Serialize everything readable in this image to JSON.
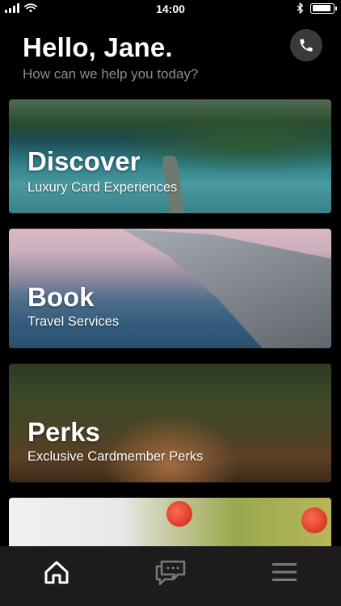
{
  "status_bar": {
    "time": "14:00",
    "signal_bars": 4,
    "battery_level": 0.92
  },
  "header": {
    "greeting": "Hello, Jane.",
    "subtitle": "How can we help you today?",
    "call_icon": "phone-icon"
  },
  "cards": [
    {
      "title": "Discover",
      "subtitle": "Luxury Card Experiences"
    },
    {
      "title": "Book",
      "subtitle": "Travel Services"
    },
    {
      "title": "Perks",
      "subtitle": "Exclusive Cardmember Perks"
    },
    {
      "title": "",
      "subtitle": ""
    }
  ],
  "tab_bar": {
    "tabs": [
      {
        "icon": "home-icon",
        "active": true
      },
      {
        "icon": "chat-icon",
        "active": false
      },
      {
        "icon": "menu-icon",
        "active": false
      }
    ]
  },
  "colors": {
    "background": "#000000",
    "subtitle_gray": "#8d8d8d",
    "tab_bar": "#1c1c1c",
    "tab_inactive": "#7a7a7a",
    "tab_active": "#ffffff"
  }
}
